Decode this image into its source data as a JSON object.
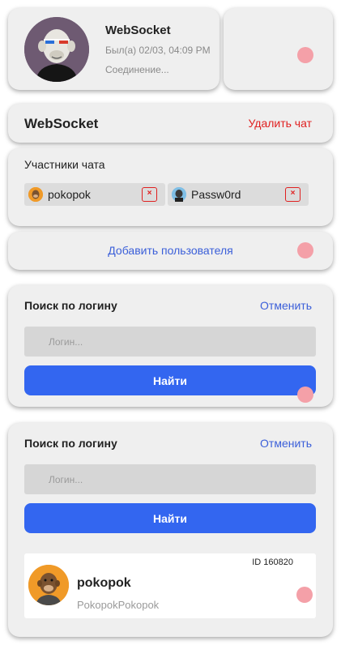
{
  "header": {
    "name": "WebSocket",
    "last_seen": "Был(а) 02/03, 04:09 PM",
    "connection_status": "Соединение..."
  },
  "chat": {
    "title": "WebSocket",
    "delete_label": "Удалить чат"
  },
  "participants": {
    "label": "Участники чата",
    "items": [
      {
        "name": "pokopok",
        "remove_label": "×"
      },
      {
        "name": "Passw0rd",
        "remove_label": "×"
      }
    ]
  },
  "add_user": {
    "label": "Добавить пользователя"
  },
  "search_panels": [
    {
      "label": "Поиск по логину",
      "cancel_label": "Отменить",
      "input_placeholder": "Логин...",
      "input_value": "",
      "button_label": "Найти"
    },
    {
      "label": "Поиск по логину",
      "cancel_label": "Отменить",
      "input_placeholder": "Логин...",
      "input_value": "",
      "button_label": "Найти"
    }
  ],
  "search_result": {
    "id_label": "ID 160820",
    "name": "pokopok",
    "login": "PokopokPokopok"
  },
  "colors": {
    "card_bg": "#efefef",
    "accent_blue": "#3366f0",
    "link_blue": "#3b5fd9",
    "danger_red": "#e02020",
    "touch_dot": "#f4a0a8"
  }
}
